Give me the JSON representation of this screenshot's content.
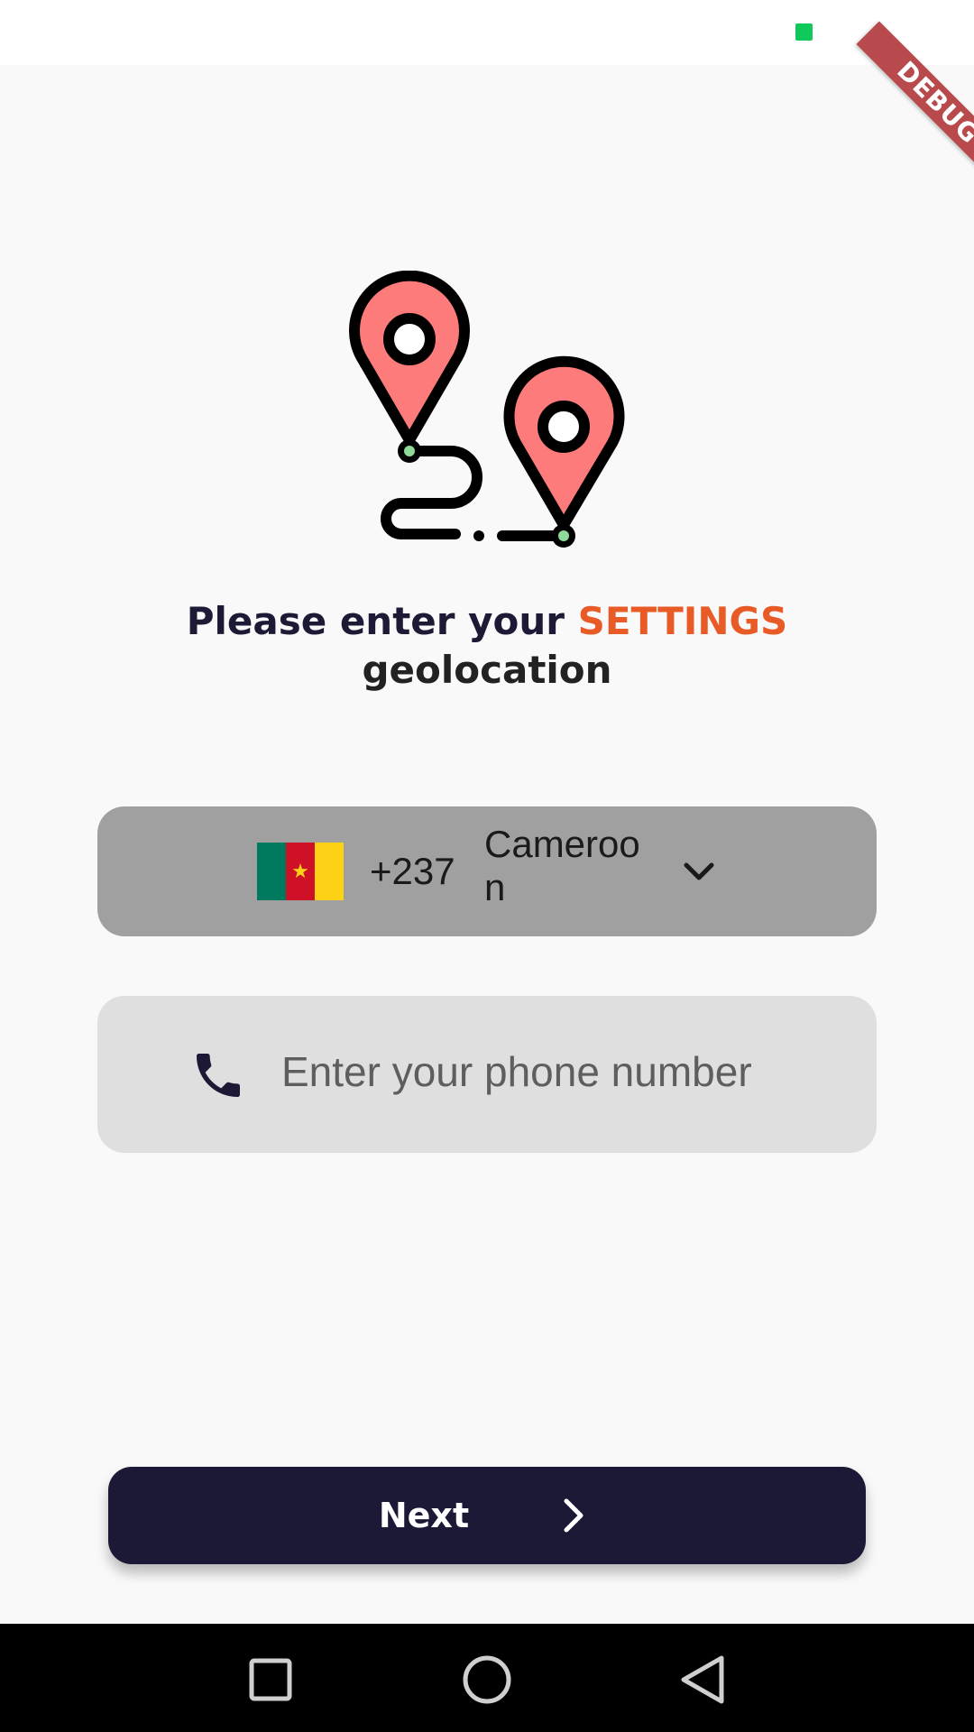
{
  "status_bar": {
    "indicator_color": "#10c95a"
  },
  "debug_banner": {
    "label": "DEBUG"
  },
  "illustration": {
    "icon": "route-pins-icon",
    "pin_color": "#fe7b7b",
    "dot_color": "#8fd99a"
  },
  "headline": {
    "prefix": "Please enter your ",
    "highlight": "SETTINGS",
    "line2": "geolocation",
    "accent_color": "#e85a26"
  },
  "country_selector": {
    "flag_icon": "cameroon-flag-icon",
    "dial_code": "+237",
    "country_name": "Cameroon",
    "dropdown_icon": "chevron-down-icon"
  },
  "phone_field": {
    "icon": "phone-icon",
    "value": "",
    "placeholder": "Enter your phone number"
  },
  "next_button": {
    "label": "Next",
    "icon": "chevron-right-icon",
    "color": "#1b1935"
  },
  "nav_bar": {
    "recents_icon": "square-recents-icon",
    "home_icon": "circle-home-icon",
    "back_icon": "triangle-back-icon"
  }
}
